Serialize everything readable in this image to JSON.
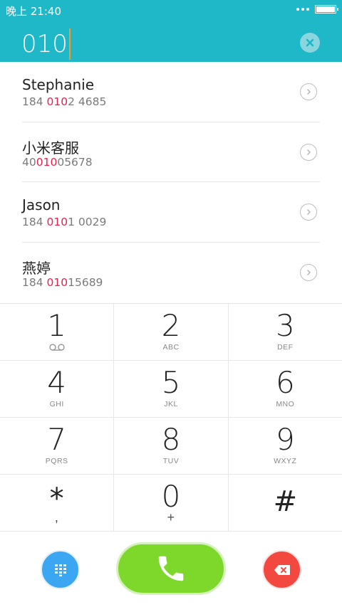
{
  "status_bar": {
    "time": "晚上 21:40",
    "more_icon": "more-dots-icon",
    "battery_icon": "battery-icon"
  },
  "dialer": {
    "input_value": "010",
    "clear_icon": "clear-icon"
  },
  "contacts": [
    {
      "name": "Stephanie",
      "number_pre": "184 ",
      "number_match": "010",
      "number_post": "2 4685"
    },
    {
      "name": "小米客服",
      "number_pre": "40",
      "number_match": "010",
      "number_post": "05678"
    },
    {
      "name": "Jason",
      "number_pre": "184 ",
      "number_match": "010",
      "number_post": "1 0029"
    },
    {
      "name": "燕婷",
      "number_pre": "184 ",
      "number_match": "010",
      "number_post": "15689"
    }
  ],
  "keypad": {
    "rows": [
      [
        {
          "digit": "1",
          "letters": ""
        },
        {
          "digit": "2",
          "letters": "ABC"
        },
        {
          "digit": "3",
          "letters": "DEF"
        }
      ],
      [
        {
          "digit": "4",
          "letters": "GHI"
        },
        {
          "digit": "5",
          "letters": "JKL"
        },
        {
          "digit": "6",
          "letters": "MNO"
        }
      ],
      [
        {
          "digit": "7",
          "letters": "PQRS"
        },
        {
          "digit": "8",
          "letters": "TUV"
        },
        {
          "digit": "9",
          "letters": "WXYZ"
        }
      ],
      [
        {
          "digit": "*",
          "letters": ","
        },
        {
          "digit": "0",
          "letters": "+"
        },
        {
          "digit": "#",
          "letters": ""
        }
      ]
    ]
  },
  "actions": {
    "keypad_icon": "keypad-grid-icon",
    "call_icon": "phone-icon",
    "delete_icon": "backspace-icon"
  },
  "colors": {
    "header": "#1fb8c8",
    "highlight": "#e8204d",
    "call": "#7ed82b",
    "keypad_btn": "#3ba6f2",
    "delete_btn": "#f2483f"
  }
}
